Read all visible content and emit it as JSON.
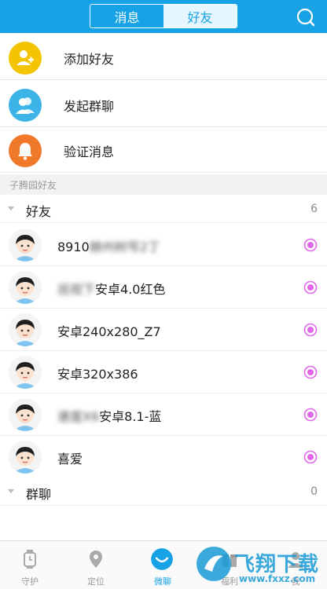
{
  "header": {
    "tabs": [
      {
        "label": "消息",
        "active": true
      },
      {
        "label": "好友",
        "active": false
      }
    ],
    "search_icon": "search-icon"
  },
  "actions": [
    {
      "label": "添加好友",
      "icon": "add-friend-icon",
      "color": "#f5c400"
    },
    {
      "label": "发起群聊",
      "icon": "group-chat-icon",
      "color": "#3db4e8"
    },
    {
      "label": "验证消息",
      "icon": "bell-icon",
      "color": "#f07a2a"
    }
  ],
  "section": {
    "title": "子腾园好友"
  },
  "groups": {
    "friends": {
      "name": "好友",
      "count": "6"
    },
    "group_chat": {
      "name": "群聊",
      "count": "0"
    }
  },
  "friends": [
    {
      "name": "8910",
      "blurred": "赫州树号2丁"
    },
    {
      "name": "安卓4.0红色",
      "blurred": "巡视下"
    },
    {
      "name": "安卓240x280_Z7",
      "blurred": ""
    },
    {
      "name": "安卓320x386",
      "blurred": ""
    },
    {
      "name": "安卓8.1-蓝",
      "blurred": "速度X6"
    },
    {
      "name": "喜爱",
      "blurred": ""
    }
  ],
  "bottom_nav": [
    {
      "label": "守护",
      "icon": "watch-icon",
      "active": false
    },
    {
      "label": "定位",
      "icon": "location-pin-icon",
      "active": false
    },
    {
      "label": "微聊",
      "icon": "chat-icon",
      "active": true
    },
    {
      "label": "福利",
      "icon": "gift-icon",
      "active": false
    },
    {
      "label": "我",
      "icon": "profile-icon",
      "active": false
    }
  ],
  "watermark": {
    "text": "飞翔下载",
    "url": "www.fxxz.com"
  },
  "colors": {
    "accent": "#17a2e6",
    "pin": "#e266e8"
  }
}
